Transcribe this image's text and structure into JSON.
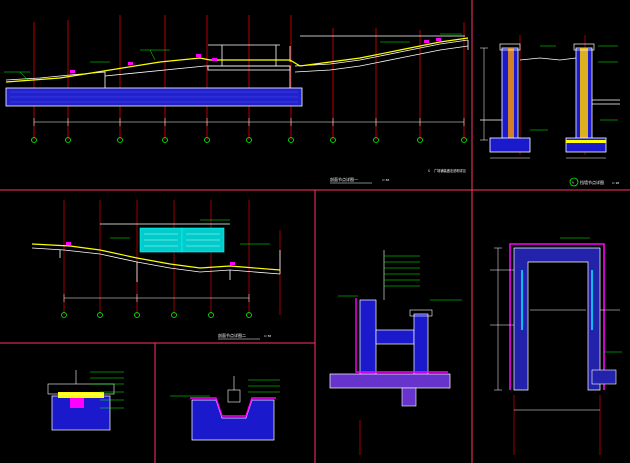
{
  "drawing": {
    "background": "#000000",
    "colors": {
      "frame": "#ff3366",
      "outline": "#ffffff",
      "ground": "#ffff00",
      "grid": "#ff0000",
      "grid_bubble": "#00ff00",
      "dims": "#00ff00",
      "hatch_slab": "#3333ff",
      "hatch_membrane": "#ff00ff",
      "glazing": "#00ffff",
      "leader": "#00ff00"
    },
    "panels": {
      "section_1": {
        "title": "剖面节点详图一",
        "scale": "1:50",
        "note": "S",
        "note_text": "广场铺装做法说明详见"
      },
      "detail_a": {
        "title": "挡墙节点详图",
        "scale": "1:20",
        "marker": "A"
      },
      "section_2": {
        "title": "剖面节点详图二",
        "scale": "1:50"
      },
      "detail_b": {
        "title": "",
        "scale": ""
      },
      "detail_c": {
        "title": "",
        "scale": ""
      },
      "detail_d": {
        "title": "",
        "scale": ""
      },
      "detail_e": {
        "title": "",
        "scale": ""
      }
    }
  }
}
